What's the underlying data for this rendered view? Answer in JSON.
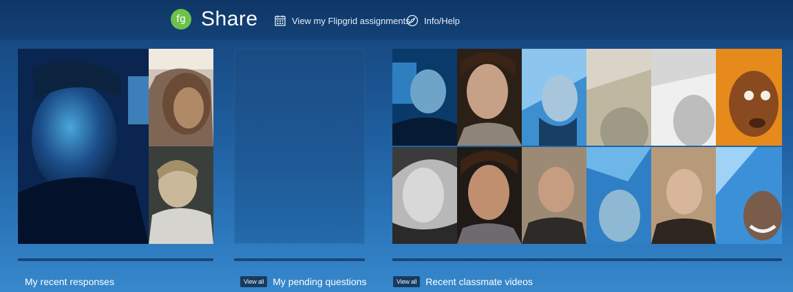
{
  "app": {
    "logo_text": "fg",
    "title": "Share"
  },
  "nav": {
    "assignments_label": "View my Flipgrid assignments",
    "assignments_icon": "calendar-grid-icon",
    "help_label": "Info/Help",
    "help_icon": "compass-icon"
  },
  "sections": {
    "recent_responses": {
      "label": "My recent responses"
    },
    "pending_questions": {
      "label": "My pending questions",
      "view_all": "View all"
    },
    "classmate_videos": {
      "label": "Recent classmate videos",
      "view_all": "View all"
    }
  },
  "colors": {
    "brand_green": "#6cc24a",
    "header_bg": "#134277",
    "view_all_bg": "#173a5f"
  }
}
